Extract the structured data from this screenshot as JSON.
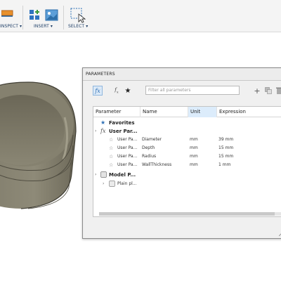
{
  "toolbar": {
    "inspect_label": "INSPECT ▾",
    "insert_label": "INSERT ▾",
    "select_label": "SELECT ▾"
  },
  "dialog": {
    "title": "PARAMETERS",
    "filter_placeholder": "Filter all parameters",
    "columns": [
      "Parameter",
      "Name",
      "Unit",
      "Expression"
    ],
    "favorites_label": "Favorites",
    "user_params_label": "User Par...",
    "model_params_label": "Model P...",
    "user_params": [
      {
        "type": "User Pa...",
        "name": "Diameter",
        "unit": "mm",
        "expression": "39 mm"
      },
      {
        "type": "User Pa...",
        "name": "Depth",
        "unit": "mm",
        "expression": "15 mm"
      },
      {
        "type": "User Pa...",
        "name": "Radius",
        "unit": "mm",
        "expression": "15 mm"
      },
      {
        "type": "User Pa...",
        "name": "WallThickness",
        "unit": "mm",
        "expression": "1 mm"
      }
    ],
    "model_children": [
      {
        "label": "Plain pl..."
      }
    ]
  },
  "colors": {
    "accent": "#2e6fb5",
    "sorted_header": "#dcecfb",
    "model_body": "#7b7766"
  }
}
